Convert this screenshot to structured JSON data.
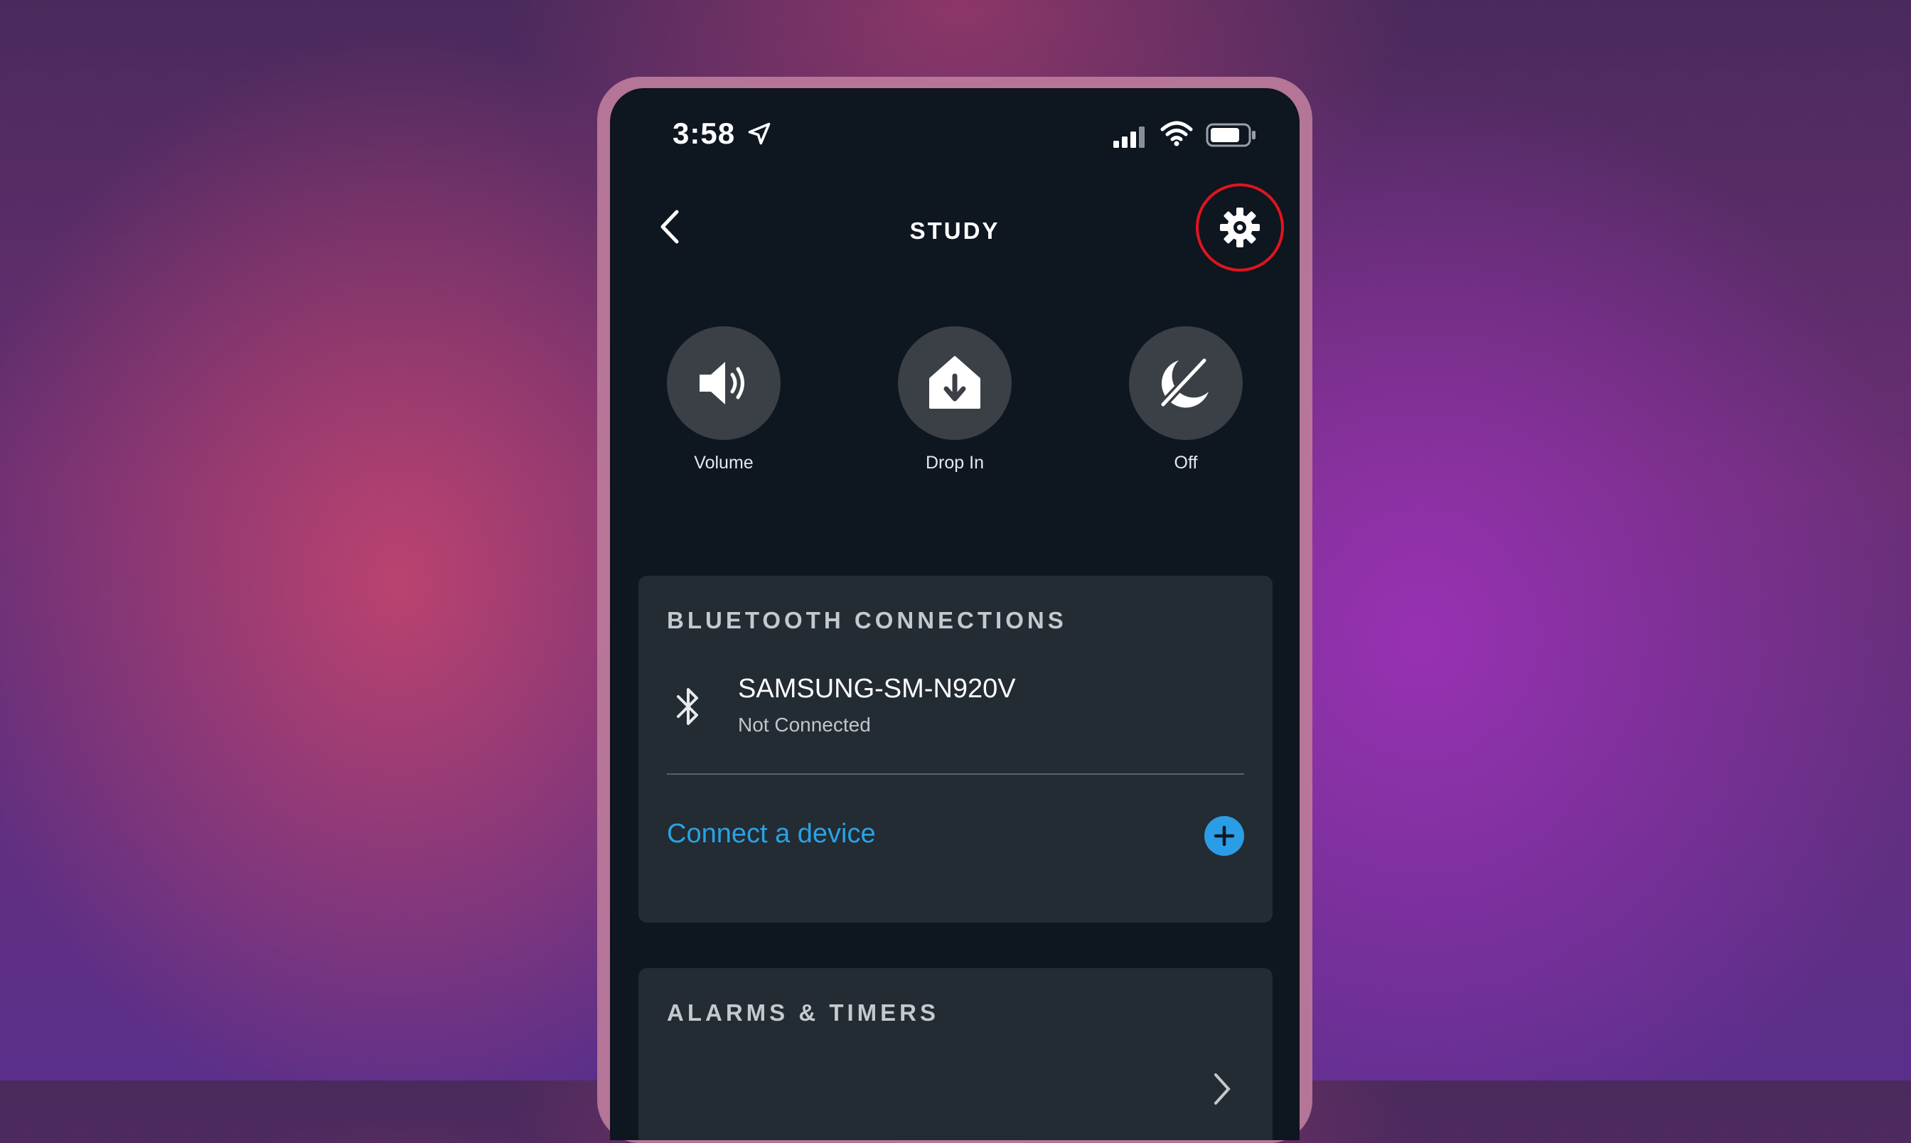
{
  "status_bar": {
    "time": "3:58"
  },
  "header": {
    "title": "STUDY"
  },
  "quick_actions": [
    {
      "label": "Volume",
      "icon": "speaker-icon"
    },
    {
      "label": "Drop In",
      "icon": "drop-in-icon"
    },
    {
      "label": "Off",
      "icon": "do-not-disturb-icon"
    }
  ],
  "bluetooth": {
    "heading": "BLUETOOTH CONNECTIONS",
    "device_name": "SAMSUNG-SM-N920V",
    "device_status": "Not Connected",
    "connect_label": "Connect a device"
  },
  "alarms": {
    "heading": "ALARMS & TIMERS"
  },
  "colors": {
    "screen_bg": "#0e1620",
    "card_bg": "#232b33",
    "accent_blue": "#29a3e4",
    "highlight_red": "#e0141e"
  }
}
